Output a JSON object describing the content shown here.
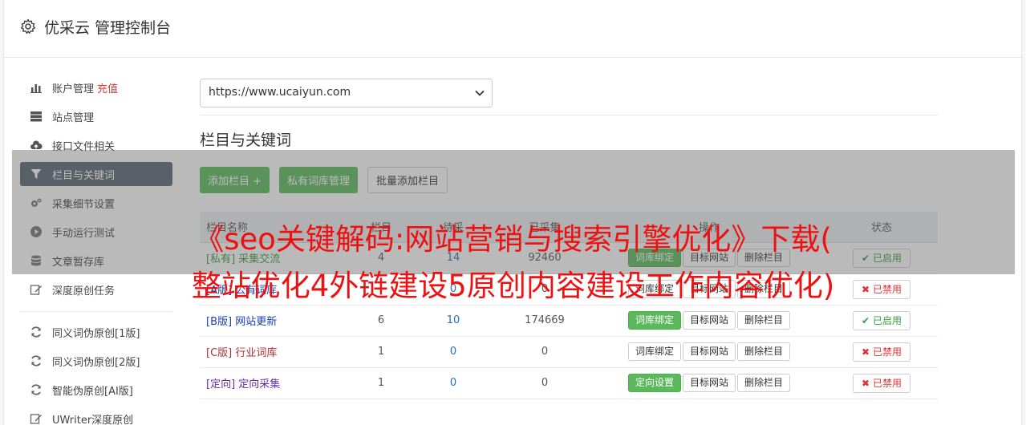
{
  "header": {
    "title": "优采云 管理控制台"
  },
  "sidebar": {
    "items": [
      {
        "label": "账户管理",
        "extra": "充值",
        "icon": "bar-chart-icon"
      },
      {
        "label": "站点管理",
        "icon": "server-icon"
      },
      {
        "label": "接口文件相关",
        "icon": "cloud-upload-icon"
      },
      {
        "label": "栏目与关键词",
        "icon": "filter-icon",
        "active": true
      },
      {
        "label": "采集细节设置",
        "icon": "cogs-icon"
      },
      {
        "label": "手动运行测试",
        "icon": "play-circle-icon"
      },
      {
        "label": "文章暂存库",
        "icon": "database-icon"
      },
      {
        "label": "深度原创任务",
        "icon": "edit-icon"
      }
    ],
    "items2": [
      {
        "label": "同义词伪原创[1版]",
        "icon": "refresh-icon"
      },
      {
        "label": "同义词伪原创[2版]",
        "icon": "refresh-icon"
      },
      {
        "label": "智能伪原创[AI版]",
        "icon": "refresh-icon"
      },
      {
        "label": "UWriter深度原创",
        "icon": "edit-icon"
      }
    ]
  },
  "main": {
    "site_select": "https://www.ucaiyun.com",
    "section_title": "栏目与关键词",
    "buttons": {
      "add": "添加栏目 +",
      "private": "私有词库管理",
      "batch": "批量添加栏目"
    },
    "table": {
      "headers": [
        "栏目名称",
        "栏目",
        "待采",
        "已采集",
        "操作",
        "状态"
      ],
      "rows": [
        {
          "tag": "[私有]",
          "name": "采集交流",
          "a": "4",
          "b": "14",
          "c": "92460",
          "op1": "词库绑定",
          "op2": "目标网站",
          "op3": "删除栏目",
          "status": "已启用",
          "on": true,
          "color": "green",
          "op1green": true
        },
        {
          "tag": "[A版]",
          "name": "公有词库",
          "a": "",
          "b": "0",
          "c": "0",
          "op1": "词库绑定",
          "op2": "目标网站",
          "op3": "删除栏目",
          "status": "已禁用",
          "on": false,
          "color": "blue",
          "op1green": false
        },
        {
          "tag": "[B版]",
          "name": "网站更新",
          "a": "6",
          "b": "10",
          "c": "174669",
          "op1": "词库绑定",
          "op2": "目标网站",
          "op3": "删除栏目",
          "status": "已启用",
          "on": true,
          "color": "blue",
          "op1green": true
        },
        {
          "tag": "[C版]",
          "name": "行业词库",
          "a": "1",
          "b": "0",
          "c": "0",
          "op1": "词库绑定",
          "op2": "目标网站",
          "op3": "删除栏目",
          "status": "已禁用",
          "on": false,
          "color": "red",
          "op1green": false
        },
        {
          "tag": "[定向]",
          "name": "定向采集",
          "a": "1",
          "b": "0",
          "c": "0",
          "op1": "定向设置",
          "op2": "目标网站",
          "op3": "删除栏目",
          "status": "已禁用",
          "on": false,
          "color": "purple",
          "op1green": true
        }
      ]
    }
  },
  "overlay": {
    "line1": "《seo关键解码:网站营销与搜索引擎优化》下载(",
    "line2": "整站优化4外链建设5原创内容建设工作内容优化)"
  }
}
